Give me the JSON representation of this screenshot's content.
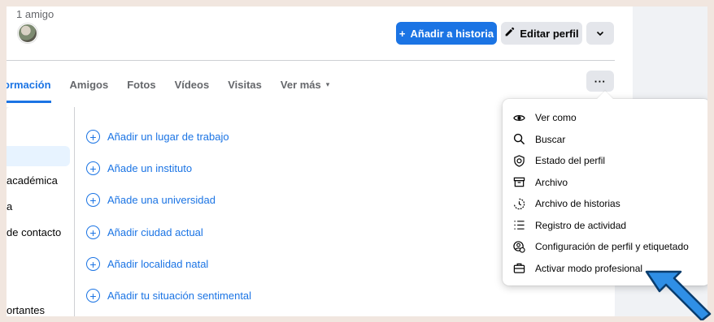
{
  "profile": {
    "friends_count": "1 amigo",
    "add_story_label": "Añadir a historia",
    "add_story_prefix": "+",
    "edit_profile_label": "Editar perfil",
    "more_chevron": "⌄",
    "more_dots": "···"
  },
  "tabs": [
    {
      "label": "ormación",
      "active": true
    },
    {
      "label": "Amigos"
    },
    {
      "label": "Fotos"
    },
    {
      "label": "Vídeos"
    },
    {
      "label": "Visitas"
    },
    {
      "label": "Ver más",
      "caret": "▾"
    }
  ],
  "left_nav": [
    {
      "label": "académica"
    },
    {
      "label": "a"
    },
    {
      "label": "de contacto"
    },
    {
      "label": "ortantes"
    }
  ],
  "add_items": [
    {
      "label": "Añadir un lugar de trabajo"
    },
    {
      "label": "Añade un instituto"
    },
    {
      "label": "Añade una universidad"
    },
    {
      "label": "Añadir ciudad actual"
    },
    {
      "label": "Añadir localidad natal"
    },
    {
      "label": "Añadir tu situación sentimental"
    }
  ],
  "menu": [
    {
      "label": "Ver como",
      "icon": "eye-icon"
    },
    {
      "label": "Buscar",
      "icon": "search-icon"
    },
    {
      "label": "Estado del perfil",
      "icon": "shield-icon"
    },
    {
      "label": "Archivo",
      "icon": "archive-icon"
    },
    {
      "label": "Archivo de historias",
      "icon": "clock-icon"
    },
    {
      "label": "Registro de actividad",
      "icon": "list-icon"
    },
    {
      "label": "Configuración de perfil y etiquetado",
      "icon": "profile-settings-icon"
    },
    {
      "label": "Activar modo profesional",
      "icon": "briefcase-icon"
    }
  ],
  "colors": {
    "accent": "#1b74e4",
    "arrow": "#2f8fe6"
  }
}
